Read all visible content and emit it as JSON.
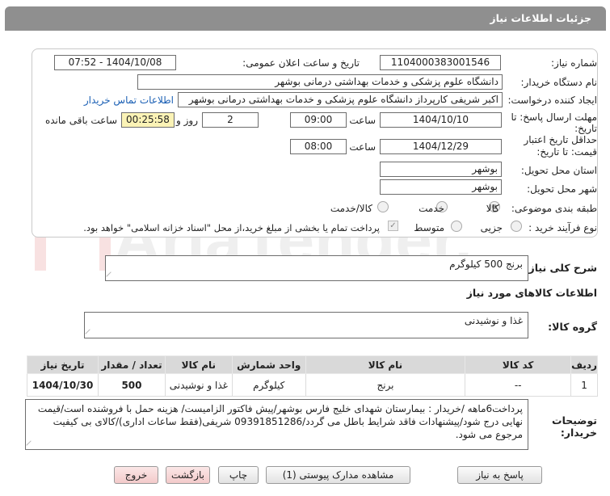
{
  "header": {
    "title": "جزئیات اطلاعات نیاز"
  },
  "form": {
    "need_number": {
      "label": "شماره نیاز:",
      "value": "1104000383001546"
    },
    "announce_datetime": {
      "label": "تاریخ و ساعت اعلان عمومی:",
      "value": "1404/10/08 - 07:52"
    },
    "buyer_org": {
      "label": "نام دستگاه خریدار:",
      "value": "دانشگاه علوم پزشکی و خدمات بهداشتی درمانی بوشهر"
    },
    "requester": {
      "label": "ایجاد کننده درخواست:",
      "value": "اکبر شریفی کارپرداز دانشگاه علوم پزشکی و خدمات بهداشتی درمانی بوشهر",
      "contact_link": "اطلاعات تماس خریدار"
    },
    "reply_deadline": {
      "label_line1": "مهلت ارسال پاسخ: تا",
      "label_line2": "تاریخ:",
      "date": "1404/10/10",
      "time_label": "ساعت",
      "time": "09:00",
      "days": "2",
      "days_label": "روز و",
      "remaining": "00:25:58",
      "remaining_label": "ساعت باقی مانده"
    },
    "price_validity": {
      "label_line1": "حداقل تاریخ اعتبار",
      "label_line2": "قیمت: تا تاریخ:",
      "date": "1404/12/29",
      "time_label": "ساعت",
      "time": "08:00"
    },
    "delivery_province": {
      "label": "استان محل تحویل:",
      "value": "بوشهر"
    },
    "delivery_city": {
      "label": "شهر محل تحویل:",
      "value": "بوشهر"
    },
    "category": {
      "label": "طبقه بندی موضوعی:",
      "options": [
        "کالا",
        "خدمت",
        "کالا/خدمت"
      ],
      "selected": "کالا"
    },
    "purchase_type": {
      "label": "نوع فرآیند خرید :",
      "options": [
        "جزیی",
        "متوسط"
      ],
      "note": "پرداخت تمام یا بخشی از مبلغ خرید،از محل \"اسناد خزانه اسلامی\" خواهد بود."
    }
  },
  "summary": {
    "label": "شرح کلی نیاز:",
    "value": "برنج 500 کیلوگرم"
  },
  "goods_info": {
    "title": "اطلاعات کالاهای مورد نیاز",
    "group_label": "گروه کالا:",
    "group_value": "غذا و نوشیدنی"
  },
  "table": {
    "columns": [
      "ردیف",
      "کد کالا",
      "نام کالا",
      "واحد شمارش",
      "نام کالا",
      "تعداد / مقدار",
      "تاریخ نیاز"
    ],
    "headers": {
      "row": "ردیف",
      "code": "کد کالا",
      "name": "نام کالا",
      "unit": "واحد شمارش",
      "group": "نام کالا",
      "qty": "تعداد / مقدار",
      "date": "تاریخ نیاز"
    },
    "rows": [
      {
        "row": "1",
        "code": "--",
        "name": "برنج",
        "unit": "کیلوگرم",
        "group": "غذا و نوشیدنی",
        "qty": "500",
        "date": "1404/10/30"
      }
    ]
  },
  "buyer_notes": {
    "label": "توضیحات خریدار:",
    "value": "پرداخت6ماهه /خریدار : بیمارستان شهدای خلیج فارس بوشهر/پیش فاکتور الزامیست/ هزینه حمل با فروشنده است/قیمت نهایی درج شود/پیشنهادات فاقد شرایط باطل می گردد/09391851286 شریفی(فقط ساعات اداری)/کالای بی کیفیت مرجوع می شود."
  },
  "buttons": {
    "reply": "پاسخ به نیاز",
    "view_docs": "مشاهده مدارک پیوستی (1)",
    "print": "چاپ",
    "back": "بازگشت",
    "exit": "خروج"
  },
  "watermark": {
    "text": "AriaTender.neT"
  },
  "colors": {
    "header_bg": "#8f8f8f",
    "link": "#1a5fb4",
    "yellow_field": "#fbf3b6",
    "pink_button": "#f3caca"
  }
}
